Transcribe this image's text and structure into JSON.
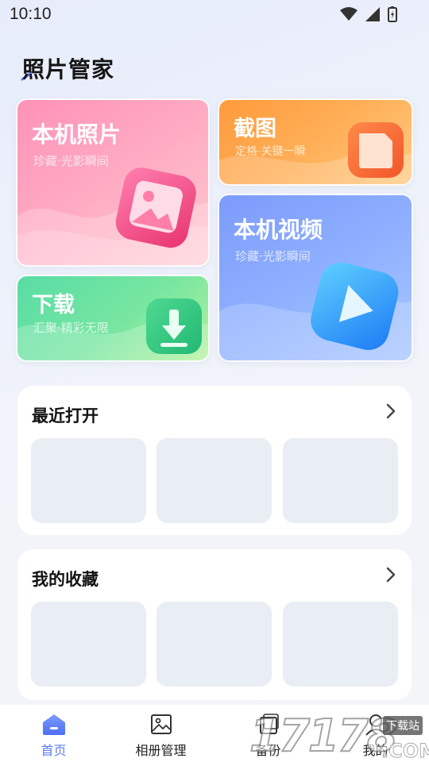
{
  "status": {
    "time": "10:10"
  },
  "app": {
    "title": "照片管家"
  },
  "cards": {
    "photos": {
      "title": "本机照片",
      "subtitle": "珍藏·光影瞬间"
    },
    "screenshot": {
      "title": "截图",
      "subtitle": "定格·关键一瞬"
    },
    "download": {
      "title": "下载",
      "subtitle": "汇聚·精彩无限"
    },
    "videos": {
      "title": "本机视频",
      "subtitle": "珍藏·光影瞬间"
    }
  },
  "sections": {
    "recent": {
      "title": "最近打开"
    },
    "favorites": {
      "title": "我的收藏"
    }
  },
  "nav": {
    "home": "首页",
    "albums": "相册管理",
    "backup": "备份",
    "mine": "我的"
  },
  "watermark": {
    "text": "17178",
    "site": "下载站",
    "domain": ".COM"
  },
  "colors": {
    "accent": "#5b7bf6",
    "photos": "#ff92b8",
    "screenshot": "#ff9a3c",
    "download": "#58dca5",
    "videos": "#7c9bfb"
  }
}
